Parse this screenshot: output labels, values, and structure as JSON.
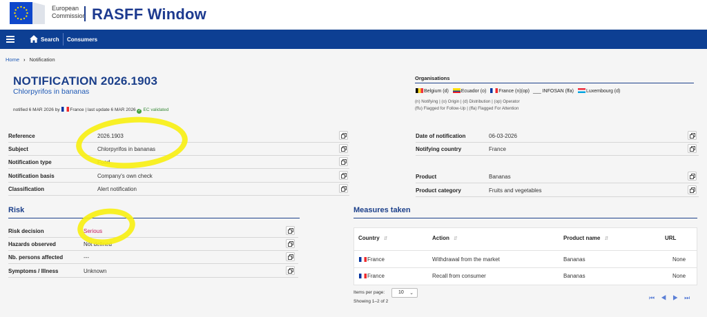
{
  "header": {
    "org_line1": "European",
    "org_line2": "Commission",
    "app_title": "RASFF Window"
  },
  "nav": {
    "search_label": "Search",
    "consumers_label": "Consumers"
  },
  "breadcrumb": {
    "home": "Home",
    "current": "Notification"
  },
  "notification": {
    "title": "NOTIFICATION 2026.1903",
    "subtitle": "Chlorpyrifos in bananas",
    "meta_prefix": "notified 6 MAR 2026 by",
    "meta_country": "France",
    "meta_update": "| last update 6 MAR 2026",
    "validated": "EC validated"
  },
  "organisations": {
    "heading": "Organisations",
    "items": [
      {
        "flag": "be",
        "label": "Belgium (d)"
      },
      {
        "flag": "ec",
        "label": "Ecuador (o)"
      },
      {
        "flag": "fr",
        "label": "France (n)(op)"
      },
      {
        "flag": "none",
        "label": "___ INFOSAN (ffa)"
      },
      {
        "flag": "lu",
        "label": "Luxembourg (d)"
      }
    ],
    "legend1": "(n) Notifying | (o) Origin | (d) Distribution | (op) Operator",
    "legend2": "(ffu) Flagged for Follow-Up | (ffa) Flagged For Attention"
  },
  "details_left": [
    {
      "label": "Reference",
      "value": "2026.1903"
    },
    {
      "label": "Subject",
      "value": "Chlorpyrifos in bananas"
    },
    {
      "label": "Notification type",
      "value": "Food"
    },
    {
      "label": "Notification basis",
      "value": "Company's own check"
    },
    {
      "label": "Classification",
      "value": "Alert notification"
    }
  ],
  "details_right": [
    {
      "label": "Date of notification",
      "value": "06-03-2026"
    },
    {
      "label": "Notifying country",
      "value": "France"
    },
    {
      "label": "Product",
      "value": "Bananas"
    },
    {
      "label": "Product category",
      "value": "Fruits and vegetables"
    }
  ],
  "risk": {
    "heading": "Risk",
    "rows": [
      {
        "label": "Risk decision",
        "value": "Serious"
      },
      {
        "label": "Hazards observed",
        "value": "Not defined"
      },
      {
        "label": "Nb. persons affected",
        "value": "---"
      },
      {
        "label": "Symptoms / Illness",
        "value": "Unknown"
      }
    ]
  },
  "measures": {
    "heading": "Measures taken",
    "columns": [
      "Country",
      "Action",
      "Product name",
      "URL"
    ],
    "rows": [
      {
        "country": "France",
        "action": "Withdrawal from the market",
        "product": "Bananas",
        "url": "None"
      },
      {
        "country": "France",
        "action": "Recall from consumer",
        "product": "Bananas",
        "url": "None"
      }
    ],
    "items_per_page_label": "Items per page:",
    "items_per_page": "10",
    "showing": "Showing 1–2 of 2"
  },
  "colors": {
    "brand_blue": "#0d3f93",
    "title_blue": "#1b3f8a",
    "link_blue": "#1d58b5",
    "risk_serious": "#c2185b",
    "highlight_yellow": "#f7ef14"
  }
}
